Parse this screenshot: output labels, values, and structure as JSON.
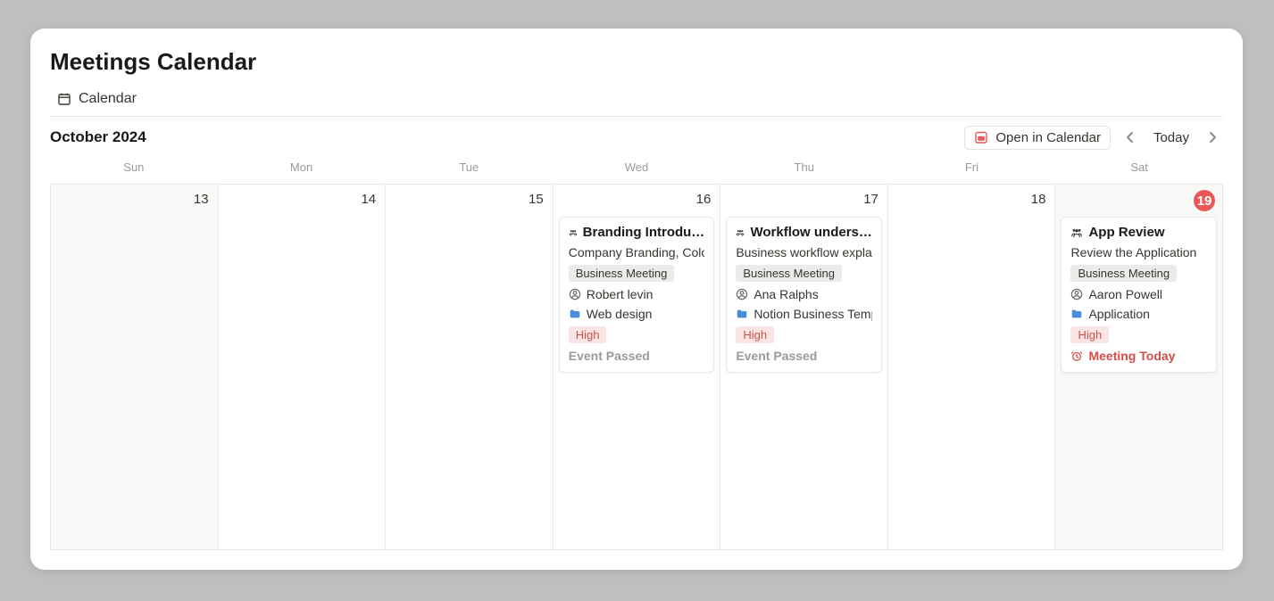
{
  "page": {
    "title": "Meetings Calendar",
    "view_tab": "Calendar",
    "month": "October 2024",
    "open_in_calendar": "Open in Calendar",
    "today_button": "Today"
  },
  "weekdays": [
    "Sun",
    "Mon",
    "Tue",
    "Wed",
    "Thu",
    "Fri",
    "Sat"
  ],
  "days": [
    {
      "num": "13",
      "weekend": true
    },
    {
      "num": "14"
    },
    {
      "num": "15"
    },
    {
      "num": "16"
    },
    {
      "num": "17"
    },
    {
      "num": "18"
    },
    {
      "num": "19",
      "weekend": true,
      "today": true
    }
  ],
  "events": {
    "wed": {
      "title": "Branding Introdu…",
      "desc": "Company Branding, Colou",
      "category": "Business Meeting",
      "person": "Robert levin",
      "project": "Web design",
      "priority": "High",
      "status": "Event Passed"
    },
    "thu": {
      "title": "Workflow unders…",
      "desc": "Business workflow explana",
      "category": "Business Meeting",
      "person": "Ana Ralphs",
      "project": "Notion Business Templa",
      "priority": "High",
      "status": "Event Passed"
    },
    "sat": {
      "title": "App Review",
      "desc": "Review the Application",
      "category": "Business Meeting",
      "person": "Aaron Powell",
      "project": "Application",
      "priority": "High",
      "status": "Meeting Today"
    }
  }
}
